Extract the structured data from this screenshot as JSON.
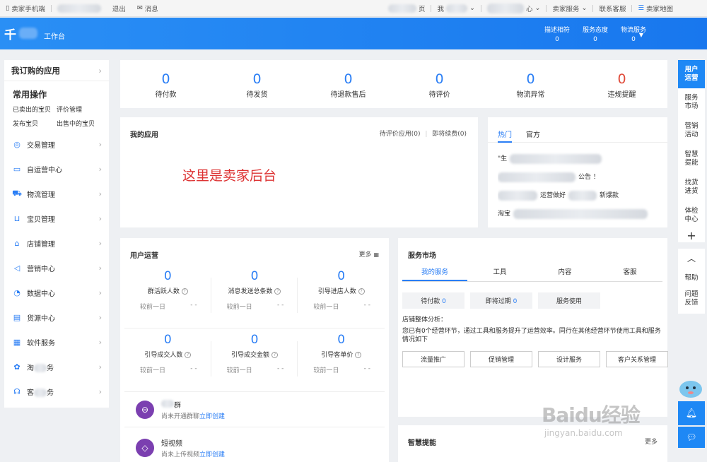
{
  "topbar": {
    "mobile_label": "卖家手机端",
    "logout": "退出",
    "messages": "消息",
    "home_partial": "页",
    "mine_partial": "我",
    "center_partial": "心",
    "seller_service": "卖家服务",
    "contact": "联系客服",
    "seller_map": "卖家地图"
  },
  "header": {
    "logo": "千",
    "workbench": "工作台",
    "stats": [
      {
        "label": "描述相符",
        "value": "0"
      },
      {
        "label": "服务态度",
        "value": "0"
      },
      {
        "label": "物流服务",
        "value": "0"
      }
    ]
  },
  "sidebar": {
    "title": "我订购的应用",
    "common_title": "常用操作",
    "quick": [
      "已卖出的宝贝",
      "评价管理",
      "发布宝贝",
      "出售中的宝贝"
    ],
    "items": [
      {
        "label": "交易管理",
        "icon": "trade-icon"
      },
      {
        "label": "自运营中心",
        "icon": "chat-bubble-icon"
      },
      {
        "label": "物流管理",
        "icon": "truck-icon"
      },
      {
        "label": "宝贝管理",
        "icon": "bag-icon"
      },
      {
        "label": "店铺管理",
        "icon": "store-icon"
      },
      {
        "label": "营销中心",
        "icon": "megaphone-icon"
      },
      {
        "label": "数据中心",
        "icon": "chart-icon"
      },
      {
        "label": "货源中心",
        "icon": "box-icon"
      },
      {
        "label": "软件服务",
        "icon": "grid-icon"
      },
      {
        "label": "淘",
        "icon": "badge-icon",
        "suffix": "务"
      },
      {
        "label": "客",
        "icon": "headset-icon",
        "suffix": "务"
      }
    ]
  },
  "stats": [
    {
      "value": "0",
      "label": "待付款"
    },
    {
      "value": "0",
      "label": "待发货"
    },
    {
      "value": "0",
      "label": "待退款售后"
    },
    {
      "value": "0",
      "label": "待评价"
    },
    {
      "value": "0",
      "label": "物流异常"
    },
    {
      "value": "0",
      "label": "违规提醒"
    }
  ],
  "apps": {
    "title": "我的应用",
    "pending": "待评价应用(0)",
    "renew": "即将续费(0)",
    "annotation": "这里是卖家后台"
  },
  "news": {
    "tabs": [
      "热门",
      "官方"
    ],
    "rows": [
      "\"生",
      "公告 ！",
      "运营做好",
      "新爆款",
      "淘宝"
    ]
  },
  "user_ops": {
    "title": "用户运营",
    "more": "更多",
    "compare_label": "较前一日",
    "compare_value": "- -",
    "metrics": [
      {
        "value": "0",
        "label": "群活跃人数"
      },
      {
        "value": "0",
        "label": "消息发送总条数"
      },
      {
        "value": "0",
        "label": "引导进店人数"
      },
      {
        "value": "0",
        "label": "引导成交人数"
      },
      {
        "value": "0",
        "label": "引导成交金额"
      },
      {
        "value": "0",
        "label": "引导客单价"
      }
    ],
    "features": [
      {
        "title": "群",
        "desc": "尚未开通群聊",
        "link": "立即创建"
      },
      {
        "title": "短视频",
        "desc": "尚未上传视频",
        "link": "立即创建"
      }
    ]
  },
  "service_market": {
    "title": "服务市场",
    "tabs": [
      "我的服务",
      "工具",
      "内容",
      "客服"
    ],
    "pills": [
      {
        "label": "待付款",
        "value": "0"
      },
      {
        "label": "即将过期",
        "value": "0"
      },
      {
        "label": "服务使用",
        "value": ""
      }
    ],
    "analysis_title": "店铺整体分析：",
    "analysis_text": "您已有0个经营环节，通过工具和服务提升了运营效率。同行在其他经营环节使用工具和服务情况如下",
    "buttons": [
      "流量推广",
      "促销管理",
      "设计服务",
      "客户关系管理"
    ]
  },
  "smart": {
    "title": "智慧提能",
    "more": "更多"
  },
  "rail": {
    "items": [
      "用户运营",
      "服务市场",
      "营销活动",
      "智慧提能",
      "找货进货",
      "体检中心"
    ],
    "plus": "+",
    "up": "︿",
    "help": "帮助",
    "feedback": "问题反馈"
  },
  "watermark": {
    "brand": "Baidu经验",
    "url": "jingyan.baidu.com"
  }
}
